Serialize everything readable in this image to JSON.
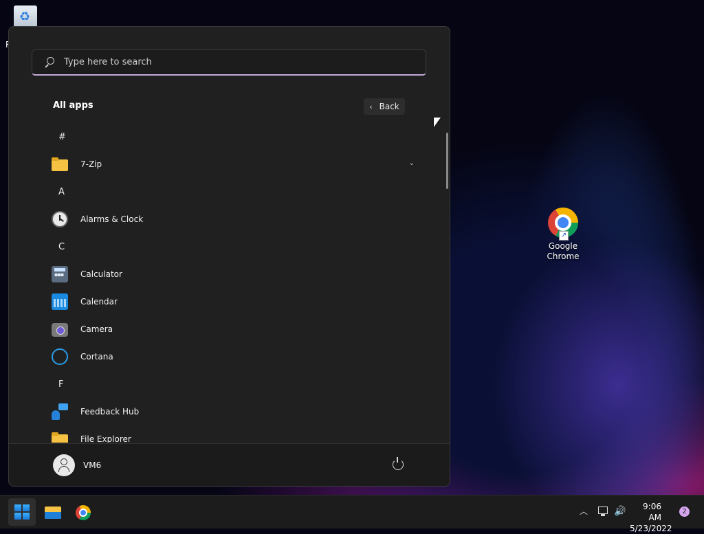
{
  "desktop": {
    "recycle_bin_label": "R",
    "chrome_label_line1": "Google",
    "chrome_label_line2": "Chrome"
  },
  "start_menu": {
    "search": {
      "placeholder": "Type here to search",
      "value": ""
    },
    "all_apps_title": "All apps",
    "back_label": "Back",
    "apps": [
      {
        "type": "letter",
        "label": "#"
      },
      {
        "type": "app",
        "label": "7-Zip",
        "icon": "folder-icon",
        "expandable": true
      },
      {
        "type": "letter",
        "label": "A"
      },
      {
        "type": "app",
        "label": "Alarms & Clock",
        "icon": "alarm-clock-icon"
      },
      {
        "type": "letter",
        "label": "C"
      },
      {
        "type": "app",
        "label": "Calculator",
        "icon": "calculator-icon"
      },
      {
        "type": "app",
        "label": "Calendar",
        "icon": "calendar-icon"
      },
      {
        "type": "app",
        "label": "Camera",
        "icon": "camera-icon"
      },
      {
        "type": "app",
        "label": "Cortana",
        "icon": "cortana-icon"
      },
      {
        "type": "letter",
        "label": "F"
      },
      {
        "type": "app",
        "label": "Feedback Hub",
        "icon": "feedback-hub-icon"
      },
      {
        "type": "app",
        "label": "File Explorer",
        "icon": "folder-icon"
      }
    ],
    "user_name": "VM6"
  },
  "taskbar": {
    "time": "9:06 AM",
    "date": "5/23/2022",
    "notification_count": "2"
  }
}
